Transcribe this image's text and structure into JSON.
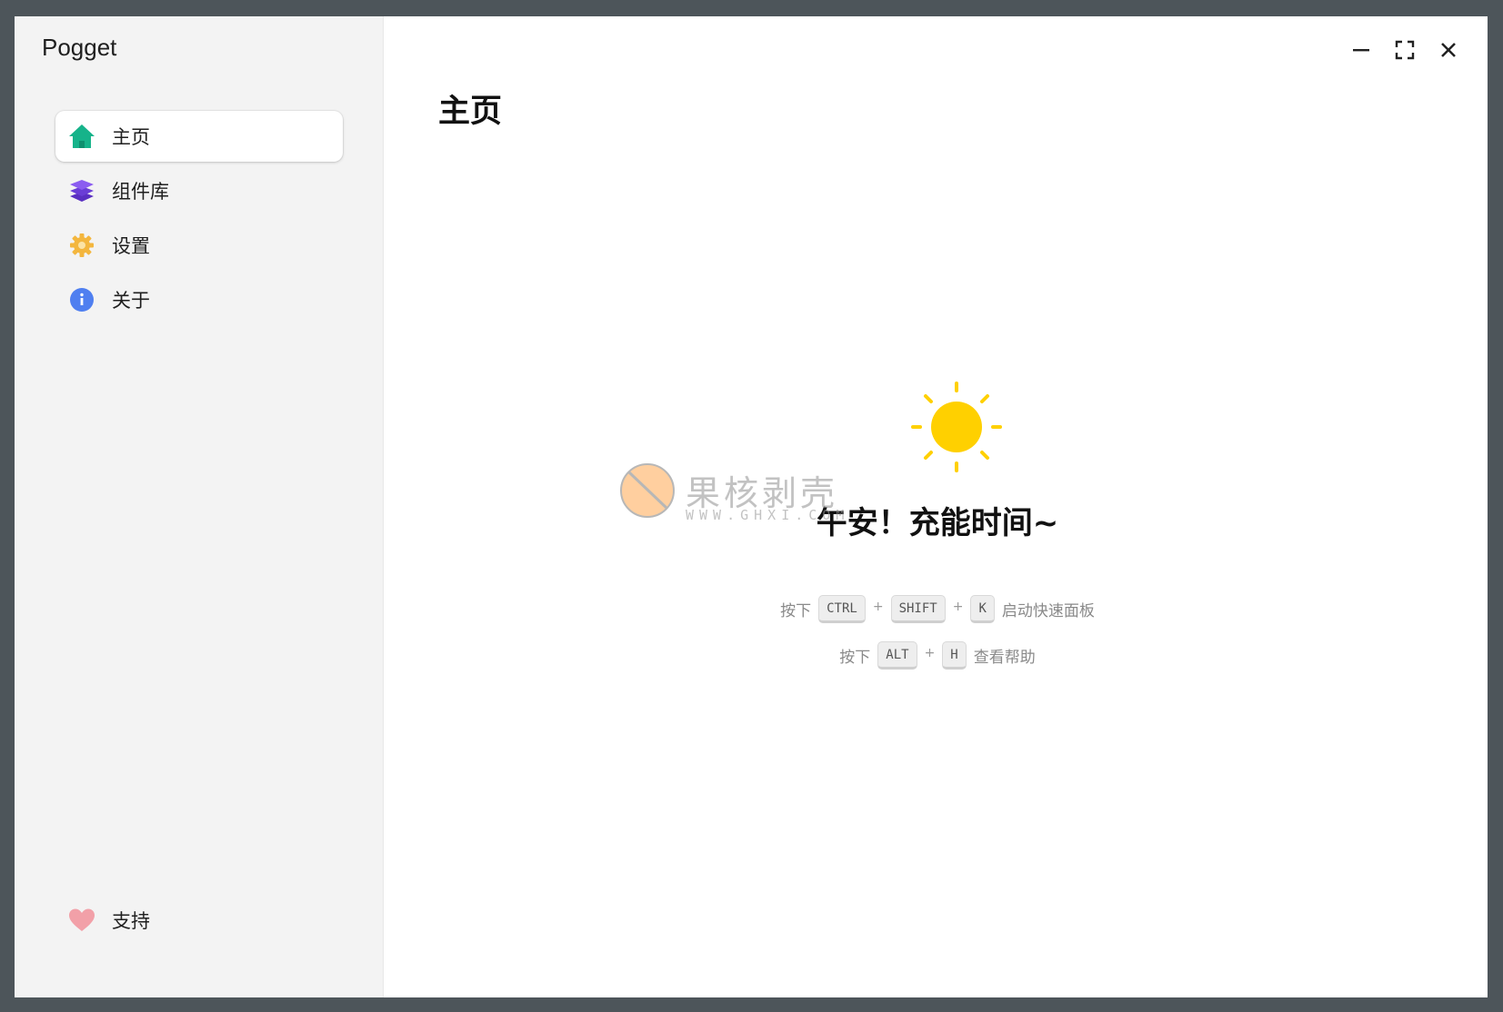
{
  "app": {
    "title": "Pogget"
  },
  "sidebar": {
    "items": [
      {
        "label": "主页",
        "icon": "home-icon",
        "active": true,
        "color": "#16b38a"
      },
      {
        "label": "组件库",
        "icon": "layers-icon",
        "active": false,
        "color": "#7b4ce0"
      },
      {
        "label": "设置",
        "icon": "gear-icon",
        "active": false,
        "color": "#f3b63e"
      },
      {
        "label": "关于",
        "icon": "info-icon",
        "active": false,
        "color": "#4f7ff0"
      }
    ],
    "support": {
      "label": "支持",
      "icon": "heart-icon",
      "color": "#f2a0a8"
    }
  },
  "window_controls": [
    "minimize-icon",
    "maximize-icon",
    "close-icon"
  ],
  "main": {
    "page_title": "主页",
    "greeting": "午安！充能时间~",
    "sun_color": "#ffd000",
    "hint1": {
      "prefix": "按下",
      "keys": [
        "CTRL",
        "SHIFT",
        "K"
      ],
      "plus": "+",
      "suffix": "启动快速面板"
    },
    "hint2": {
      "prefix": "按下",
      "keys": [
        "ALT",
        "H"
      ],
      "plus": "+",
      "suffix": "查看帮助"
    }
  },
  "watermark": {
    "text": "果核剥壳",
    "url": "WWW.GHXI.COM"
  }
}
